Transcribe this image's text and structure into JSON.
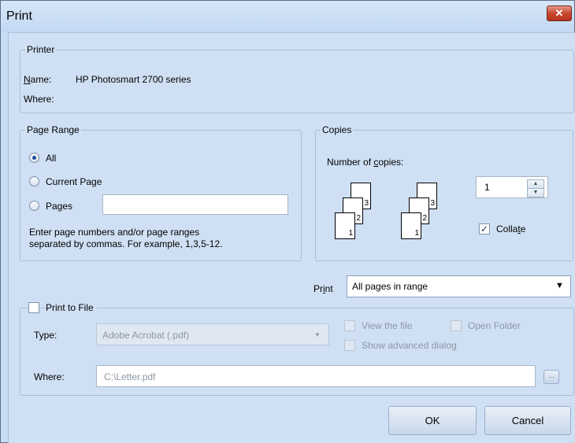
{
  "window": {
    "title": "Print",
    "close_label": "✕"
  },
  "printer": {
    "legend": "Printer",
    "name_label_pre": "",
    "name_label_u": "N",
    "name_label_post": "ame:",
    "name_value": "HP Photosmart 2700 series",
    "where_label": "Where:"
  },
  "page_range": {
    "legend": "Page Range",
    "all_label": "All",
    "current_label": "Current Page",
    "pages_label": "Pages",
    "pages_value": "",
    "selected": "All",
    "help_line1": "Enter page numbers and/or page ranges",
    "help_line2": "separated by commas.  For example, 1,3,5-12."
  },
  "copies": {
    "legend": "Copies",
    "number_label_pre": "Number of ",
    "number_label_u": "c",
    "number_label_post": "opies:",
    "number_value": "1",
    "collate_pre": "Colla",
    "collate_u": "t",
    "collate_post": "e",
    "collate_checked": true,
    "pages_set1": [
      "1",
      "2",
      "3"
    ],
    "pages_set2": [
      "1",
      "2",
      "3"
    ]
  },
  "print_select": {
    "label_pre": "Pr",
    "label_u": "i",
    "label_post": "nt",
    "value": "All pages in range"
  },
  "print_to_file": {
    "label": "Print to File",
    "checked": false,
    "type_label": "Type:",
    "type_value": "Adobe Acrobat (.pdf)",
    "view_file_label": "View the file",
    "open_folder_label": "Open Folder",
    "advanced_label": "Show advanced dialog",
    "where_label": "Where:",
    "where_value": "C:\\Letter.pdf",
    "browse_label": "..."
  },
  "buttons": {
    "ok": "OK",
    "cancel": "Cancel"
  }
}
